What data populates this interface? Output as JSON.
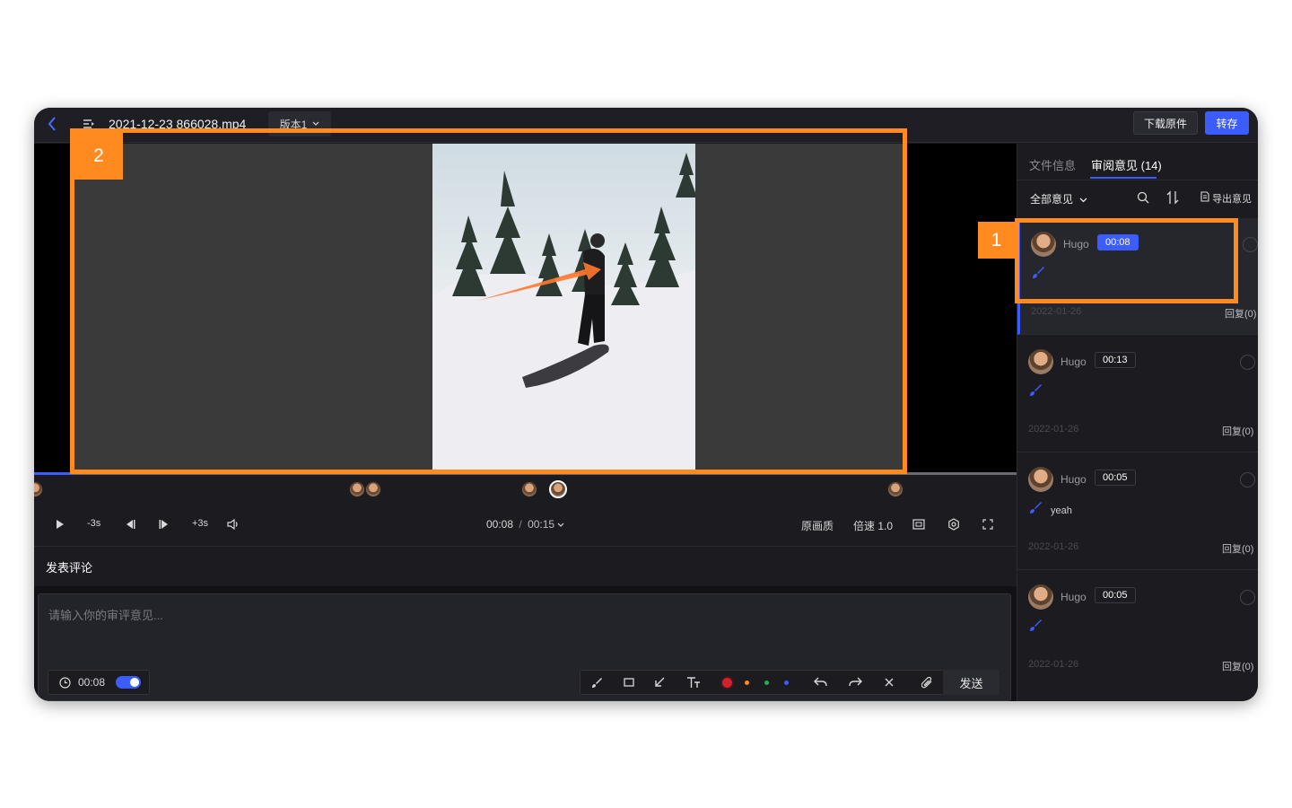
{
  "header": {
    "filename": "2021-12-23 866028.mp4",
    "version_label": "版本1",
    "download_label": "下载原件",
    "save_label": "转存"
  },
  "player": {
    "current_time": "00:08",
    "separator": "/",
    "duration": "00:15",
    "rewind_label": "-3s",
    "forward_label": "+3s",
    "quality_label": "原画质",
    "speed_label": "倍速 1.0",
    "progress": 0.04
  },
  "compose": {
    "title": "发表评论",
    "placeholder": "请输入你的审评意见...",
    "timestamp": "00:08",
    "send_label": "发送",
    "colors": [
      "#d4202c",
      "#ff8a1f",
      "#22b14c",
      "#3b5cff"
    ]
  },
  "sidebar": {
    "tab_info": "文件信息",
    "tab_review": "审阅意见 (14)",
    "filter_label": "全部意见",
    "export_label": "导出意见",
    "comments": [
      {
        "name": "Hugo",
        "time": "00:08",
        "text": "",
        "date": "2022-01-26",
        "reply": "回复(0)",
        "active": true
      },
      {
        "name": "Hugo",
        "time": "00:13",
        "text": "",
        "date": "2022-01-26",
        "reply": "回复(0)",
        "active": false
      },
      {
        "name": "Hugo",
        "time": "00:05",
        "text": "yeah",
        "date": "2022-01-26",
        "reply": "回复(0)",
        "active": false
      },
      {
        "name": "Hugo",
        "time": "00:05",
        "text": "",
        "date": "2022-01-26",
        "reply": "回复(0)",
        "active": false
      }
    ]
  },
  "annotations": {
    "badge_1": "1",
    "badge_2": "2",
    "accent": "#ff8a1f"
  },
  "accent_color": "#3b5cff"
}
